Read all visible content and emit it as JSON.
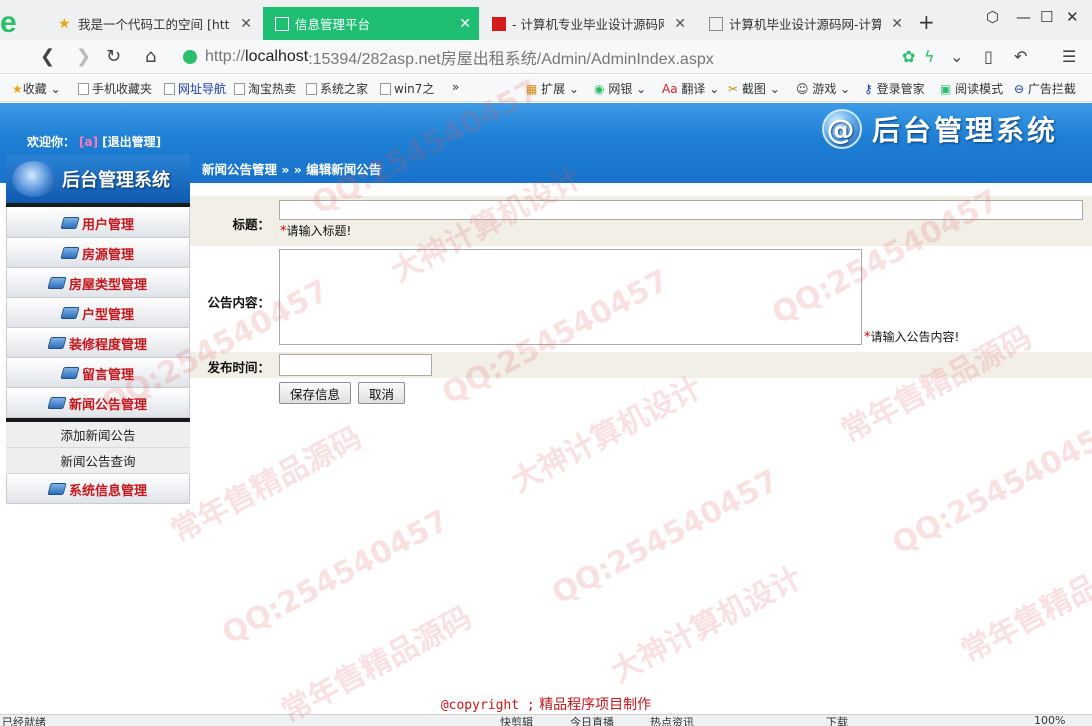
{
  "browser": {
    "tabs": [
      {
        "title": "我是一个代码工的空间 [http:",
        "active": false
      },
      {
        "title": "信息管理平台",
        "active": true
      },
      {
        "title": "- 计算机专业毕业设计源码网",
        "active": false
      },
      {
        "title": "计算机毕业设计源码网-计算机",
        "active": false
      }
    ],
    "new_tab": "+",
    "url_prefix": "http://",
    "url_host": "localhost",
    "url_rest": ":15394/282asp.net房屋出租系统/Admin/AdminIndex.aspx",
    "bookmarks": [
      "收藏",
      "手机收藏夹",
      "网址导航",
      "淘宝热卖",
      "系统之家",
      "win7之",
      "扩展",
      "网银",
      "翻译",
      "截图",
      "游戏",
      "登录管家",
      "阅读模式",
      "广告拦截"
    ],
    "bookmark_more": "»"
  },
  "header": {
    "welcome_label": "欢迎你：",
    "user": "[a]",
    "logout": "[退出管理]",
    "logo_text": "后台管理系统"
  },
  "breadcrumb": "新闻公告管理 » » 编辑新闻公告",
  "sidebar": {
    "title": "后台管理系统",
    "items": [
      "用户管理",
      "房源管理",
      "房屋类型管理",
      "户型管理",
      "装修程度管理",
      "留言管理",
      "新闻公告管理"
    ],
    "subitems": [
      "添加新闻公告",
      "新闻公告查询"
    ],
    "last_item": "系统信息管理"
  },
  "form": {
    "title_label": "标题：",
    "title_value": "",
    "title_hint": "请输入标题!",
    "content_label": "公告内容：",
    "content_value": "",
    "content_hint": "请输入公告内容!",
    "date_label": "发布时间：",
    "date_value": "",
    "required_mark": "*",
    "save_button": "保存信息",
    "cancel_button": "取消"
  },
  "footer": {
    "copyright": "@copyright ;",
    "text": "精品程序项目制作"
  },
  "statusbar": {
    "left": "已经就绪",
    "items": [
      "快剪辑",
      "今日直播",
      "热点资讯",
      "下载",
      "100%"
    ]
  },
  "watermarks": [
    "QQ:254540457",
    "大神计算机设计",
    "常年售精品源码"
  ],
  "colors": {
    "accent_green": "#1fbf73",
    "header_blue": "#1e7fd4",
    "menu_red": "#c3171c"
  }
}
